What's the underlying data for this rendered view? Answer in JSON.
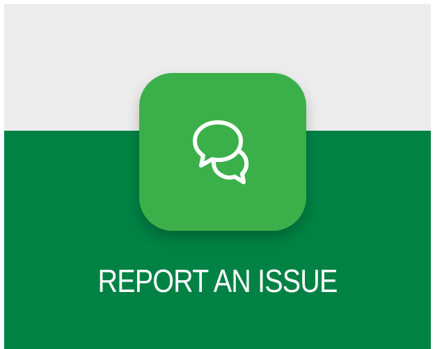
{
  "report_tile": {
    "label": "REPORT AN ISSUE",
    "icon": "chat-bubbles-icon"
  },
  "colors": {
    "background_top": "#ececec",
    "background_bottom": "#008244",
    "tile": "#3bb04a",
    "text": "#ffffff"
  }
}
